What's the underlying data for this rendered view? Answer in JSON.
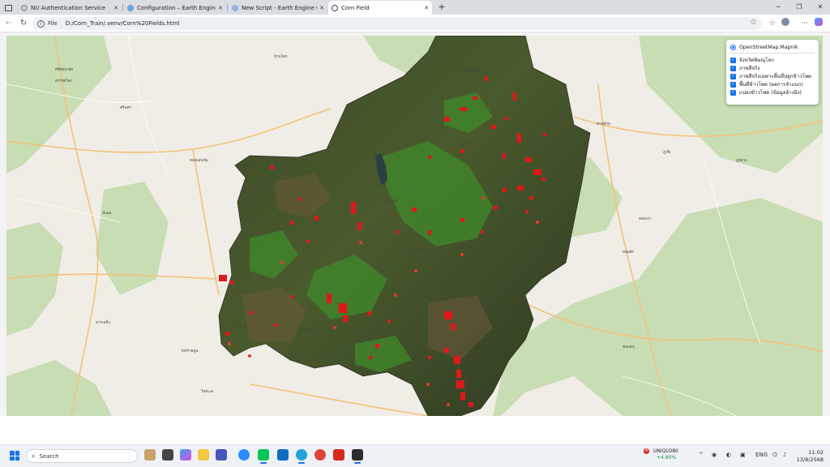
{
  "browser": {
    "tabs": [
      {
        "title": "NU Authentication Service",
        "active": false
      },
      {
        "title": "Configuration – Earth Engine – M",
        "active": false
      },
      {
        "title": "New Script - Earth Engine Code E",
        "active": false
      },
      {
        "title": "Corn Field",
        "active": true
      }
    ],
    "new_tab_glyph": "+",
    "close_glyph": "✕",
    "address": {
      "scheme_label": "File",
      "url": "D:/Corn_Train/.venv/Corn%20Fields.html"
    }
  },
  "map": {
    "layer_control": {
      "base_layer": "OpenStreetMap.Mapnik",
      "overlays": [
        {
          "label": "จังหวัดพิษณุโลก",
          "checked": true
        },
        {
          "label": "ภาพสีจริง",
          "checked": true
        },
        {
          "label": "ภาพสีจริงเฉพาะพื้นที่ปลูกข้าวโพด",
          "checked": true
        },
        {
          "label": "พื้นที่ข้าวโพด (ผลการจำแนก)",
          "checked": true
        },
        {
          "label": "แปลงข้าวโพด (ข้อมูลอ้างอิง)",
          "checked": true
        }
      ]
    },
    "place_labels": [
      "ศรีสัชนาลัย",
      "สวรรคโลก",
      "ศรีนคร",
      "ทองแสนขัน",
      "ลับแล",
      "บ้านโคก",
      "ด่านซ้าย",
      "นครไทย",
      "ชาติตระการ",
      "วังทอง",
      "วัดโบสถ์",
      "พรหมพิราม",
      "บางระกำ",
      "วังทรายพูน",
      "ชนแดน",
      "หล่มสัก",
      "ภูเรือ",
      "ภูหลวง",
      "หล่มเก่า",
      "สากเหล็ก",
      "โพทะเล"
    ],
    "colors": {
      "classified_corn": "#e0181a",
      "reference_parcels": "#e83a2a",
      "forest": "#c6ddb1",
      "water": "#aad3df",
      "road": "#f6c57a"
    }
  },
  "taskbar": {
    "search_placeholder": "Search",
    "stock": {
      "badge": "4",
      "ticker": "UNIQLO80",
      "change": "+4.90%"
    },
    "language": "ENG",
    "time": "11:02",
    "date": "13/8/2568"
  }
}
